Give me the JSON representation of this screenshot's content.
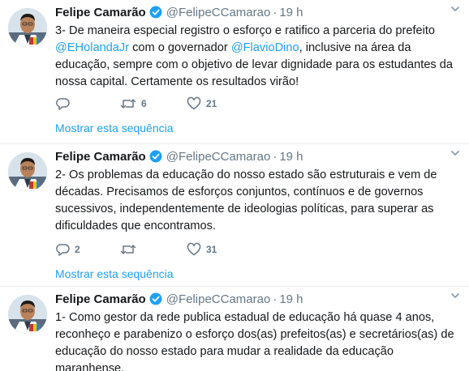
{
  "colors": {
    "accent": "#1da1f2",
    "muted": "#657786",
    "text": "#14171a",
    "divider": "#e6ecf0"
  },
  "tweets": [
    {
      "author_name": "Felipe Camarão",
      "verified_icon": "verified-badge-icon",
      "handle": "@FelipeCCamarao",
      "separator": "·",
      "time": "19 h",
      "text_parts": [
        "3- De maneira especial registro o esforço e ratifico a parceria do prefeito ",
        "@EHolandaJr",
        " com o governador ",
        "@FlavioDino",
        ", inclusive na área da educação, sempre com o objetivo de levar dignidade para os estudantes da nossa capital. Certamente os resultados virão!"
      ],
      "reply_count": "",
      "retweet_count": "6",
      "like_count": "21",
      "thread_link": "Mostrar esta sequência"
    },
    {
      "author_name": "Felipe Camarão",
      "verified_icon": "verified-badge-icon",
      "handle": "@FelipeCCamarao",
      "separator": "·",
      "time": "19 h",
      "text": "2- Os problemas da educação do nosso estado são estruturais e vem de décadas. Precisamos de esforços conjuntos, contínuos e de governos sucessivos, independentemente de ideologias políticas, para superar as dificuldades que encontramos.",
      "reply_count": "2",
      "retweet_count": "",
      "like_count": "31",
      "thread_link": "Mostrar esta sequência"
    },
    {
      "author_name": "Felipe Camarão",
      "verified_icon": "verified-badge-icon",
      "handle": "@FelipeCCamarao",
      "separator": "·",
      "time": "19 h",
      "text": "1- Como gestor da rede publica estadual de educação há quase 4 anos, reconheço e parabenizo o esforço dos(as) prefeitos(as) e secretários(as) de educação do nosso estado para mudar a realidade da educação maranhense."
    }
  ]
}
